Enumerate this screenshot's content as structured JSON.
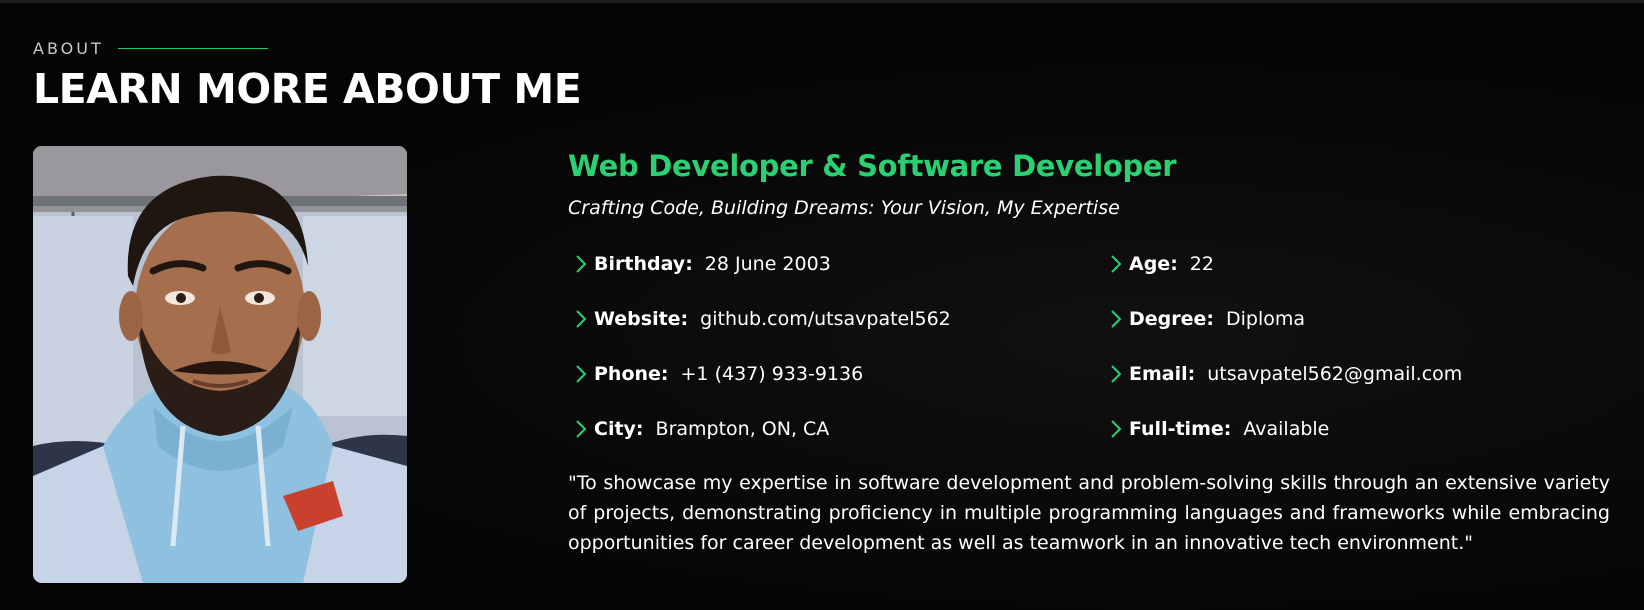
{
  "section": {
    "label": "ABOUT",
    "title": "LEARN MORE ABOUT ME"
  },
  "photo": {
    "icon": "profile-photo",
    "caption": ""
  },
  "about": {
    "role_title": "Web Developer & Software Developer",
    "tagline": "Crafting Code, Building Dreams: Your Vision, My Expertise",
    "details": [
      {
        "label": "Birthday:",
        "value": "28 June 2003"
      },
      {
        "label": "Age:",
        "value": "22"
      },
      {
        "label": "Website:",
        "value": "github.com/utsavpatel562"
      },
      {
        "label": "Degree:",
        "value": "Diploma"
      },
      {
        "label": "Phone:",
        "value": "+1 (437) 933-9136"
      },
      {
        "label": "Email:",
        "value": "utsavpatel562@gmail.com"
      },
      {
        "label": "City:",
        "value": "Brampton, ON, CA"
      },
      {
        "label": "Full-time:",
        "value": "Available"
      }
    ],
    "objective": "\"To showcase my expertise in software development and problem-solving skills through an extensive variety of projects, demonstrating proficiency in multiple programming languages and frameworks while embracing opportunities for career development as well as teamwork in an innovative tech environment.\""
  },
  "colors": {
    "accent": "#2bd072",
    "background": "#050505",
    "text": "#ffffff"
  },
  "icons": {
    "bullet": "chevron-right-icon"
  }
}
